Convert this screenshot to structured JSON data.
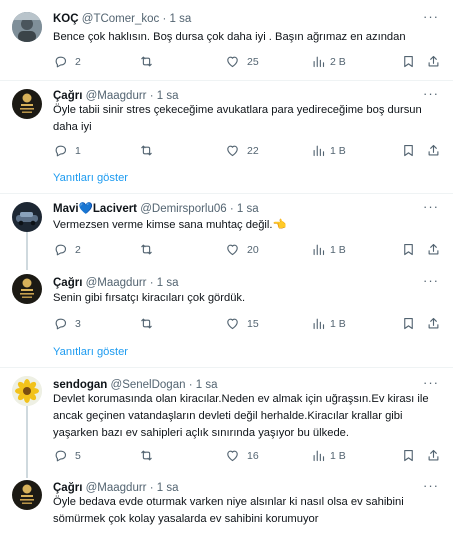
{
  "tweets": [
    {
      "name": "KOÇ",
      "handle": "@TComer_koc",
      "dot": "·",
      "time": "1 sa",
      "text": "Bence çok haklısın. Boş dursa çok daha iyi . Başın ağrımaz en azından",
      "replies": "2",
      "retweets": "",
      "likes": "25",
      "views": "2 B",
      "more": "···"
    },
    {
      "name": "Çağrı",
      "handle": "@Maagdurr",
      "dot": "·",
      "time": "1 sa",
      "text": "Öyle tabii sinir stres çekeceğime avukatlara para yedireceğime boş dursun daha iyi",
      "replies": "1",
      "retweets": "",
      "likes": "22",
      "views": "1 B",
      "more": "···"
    },
    {
      "name": "Mavi",
      "name_emoji": "💙",
      "name2": "Lacivert",
      "handle": "@Demirsporlu06",
      "dot": "·",
      "time": "1 sa",
      "text": "Vermezsen verme kimse sana muhtaç değil.",
      "text_emoji": "👈",
      "replies": "2",
      "retweets": "",
      "likes": "20",
      "views": "1 B",
      "more": "···"
    },
    {
      "name": "Çağrı",
      "handle": "@Maagdurr",
      "dot": "·",
      "time": "1 sa",
      "text": "Senin gibi fırsatçı kiracıları çok gördük.",
      "replies": "3",
      "retweets": "",
      "likes": "15",
      "views": "1 B",
      "more": "···"
    },
    {
      "name": "sendogan",
      "handle": "@SenelDogan",
      "dot": "·",
      "time": "1 sa",
      "text": "Devlet korumasında olan kiracılar.Neden ev almak için uğraşsın.Ev kirası ile ancak geçinen vatandaşların devleti değil herhalde.Kiracılar krallar gibi yaşarken bazı ev sahipleri açlık sınırında yaşıyor bu ülkede.",
      "replies": "5",
      "retweets": "",
      "likes": "16",
      "views": "1 B",
      "more": "···"
    },
    {
      "name": "Çağrı",
      "handle": "@Maagdurr",
      "dot": "·",
      "time": "1 sa",
      "text": "Öyle bedava evde oturmak varken niye alsınlar ki nasıl olsa ev sahibini sömürmek çok kolay yasalarda ev sahibini korumuyor",
      "more": "···"
    }
  ],
  "show_replies_label": "Yanıtları göster",
  "colors": {
    "accent": "#1d9bf0",
    "secondary_text": "#536471",
    "divider": "#eff3f4"
  }
}
